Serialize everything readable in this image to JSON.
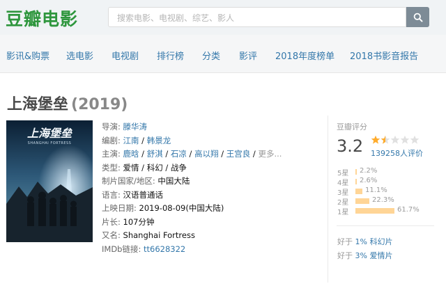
{
  "header": {
    "logo": "豆瓣电影",
    "search_placeholder": "搜索电影、电视剧、综艺、影人"
  },
  "nav": [
    "影讯&购票",
    "选电影",
    "电视剧",
    "排行榜",
    "分类",
    "影评",
    "2018年度榜单",
    "2018书影音报告"
  ],
  "movie": {
    "title": "上海堡垒",
    "year": "(2019)",
    "poster_title": "上海堡垒",
    "poster_subtitle": "SHANGHAI FORTRESS",
    "info": {
      "director_label": "导演:",
      "director": "滕华涛",
      "writer_label": "编剧:",
      "writers": [
        "江南",
        "韩景龙"
      ],
      "cast_label": "主演:",
      "cast": [
        "鹿晗",
        "舒淇",
        "石凉",
        "高以翔",
        "王宫良"
      ],
      "cast_more": "更多...",
      "genre_label": "类型:",
      "genres": "爱情 / 科幻 / 战争",
      "country_label": "制片国家/地区:",
      "country": "中国大陆",
      "language_label": "语言:",
      "language": "汉语普通话",
      "release_label": "上映日期:",
      "release": "2019-08-09(中国大陆)",
      "runtime_label": "片长:",
      "runtime": "107分钟",
      "aka_label": "又名:",
      "aka": "Shanghai Fortress",
      "imdb_label": "IMDb链接:",
      "imdb": "tt6628322"
    }
  },
  "rating": {
    "label": "豆瓣评分",
    "score": "3.2",
    "stars": 1.5,
    "votes": "139258人评价",
    "distribution": [
      {
        "label": "5星",
        "pct": "2.2%",
        "value": 2.2
      },
      {
        "label": "4星",
        "pct": "2.6%",
        "value": 2.6
      },
      {
        "label": "3星",
        "pct": "11.1%",
        "value": 11.1
      },
      {
        "label": "2星",
        "pct": "22.3%",
        "value": 22.3
      },
      {
        "label": "1星",
        "pct": "61.7%",
        "value": 61.7
      }
    ],
    "better1_prefix": "好于",
    "better1_pct": "1%",
    "better1_cat": "科幻片",
    "better2_prefix": "好于",
    "better2_pct": "3%",
    "better2_cat": "爱情片"
  },
  "colors": {
    "logo": "#2e963d",
    "link": "#3377aa",
    "star": "#ffac2d",
    "bar": "#ffd596"
  }
}
